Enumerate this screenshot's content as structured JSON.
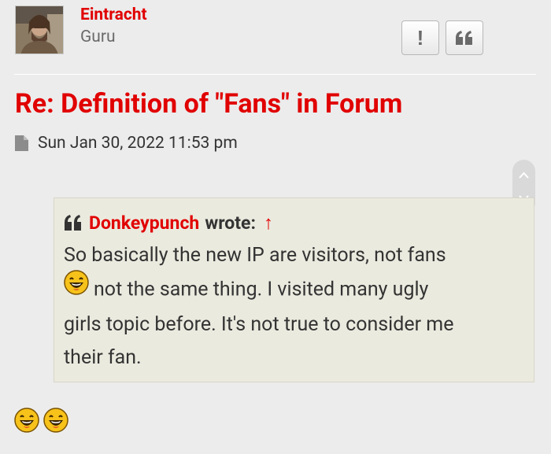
{
  "user": {
    "name": "Eintracht",
    "rank": "Guru"
  },
  "buttons": {
    "report_label": "!",
    "quote_label": "quote"
  },
  "post": {
    "title": "Re: Definition of \"Fans\" in Forum",
    "timestamp": "Sun Jan 30, 2022 11:53 pm"
  },
  "quote": {
    "author": "Donkeypunch",
    "wrote_label": "wrote:",
    "jump_symbol": "↑",
    "line1": "So basically the new IP are visitors, not fans",
    "line2": "not the same thing. I visited many ugly",
    "line3": "girls topic before. It's not true to consider me",
    "line4": "their fan."
  },
  "colors": {
    "accent": "#e10000",
    "background": "#ececec",
    "quote_bg": "#ebeadf"
  },
  "icons": [
    "user-avatar",
    "report-icon",
    "quote-icon",
    "post-file-icon",
    "scroll-up-icon",
    "scroll-down-icon",
    "laughing-smiley-icon"
  ]
}
